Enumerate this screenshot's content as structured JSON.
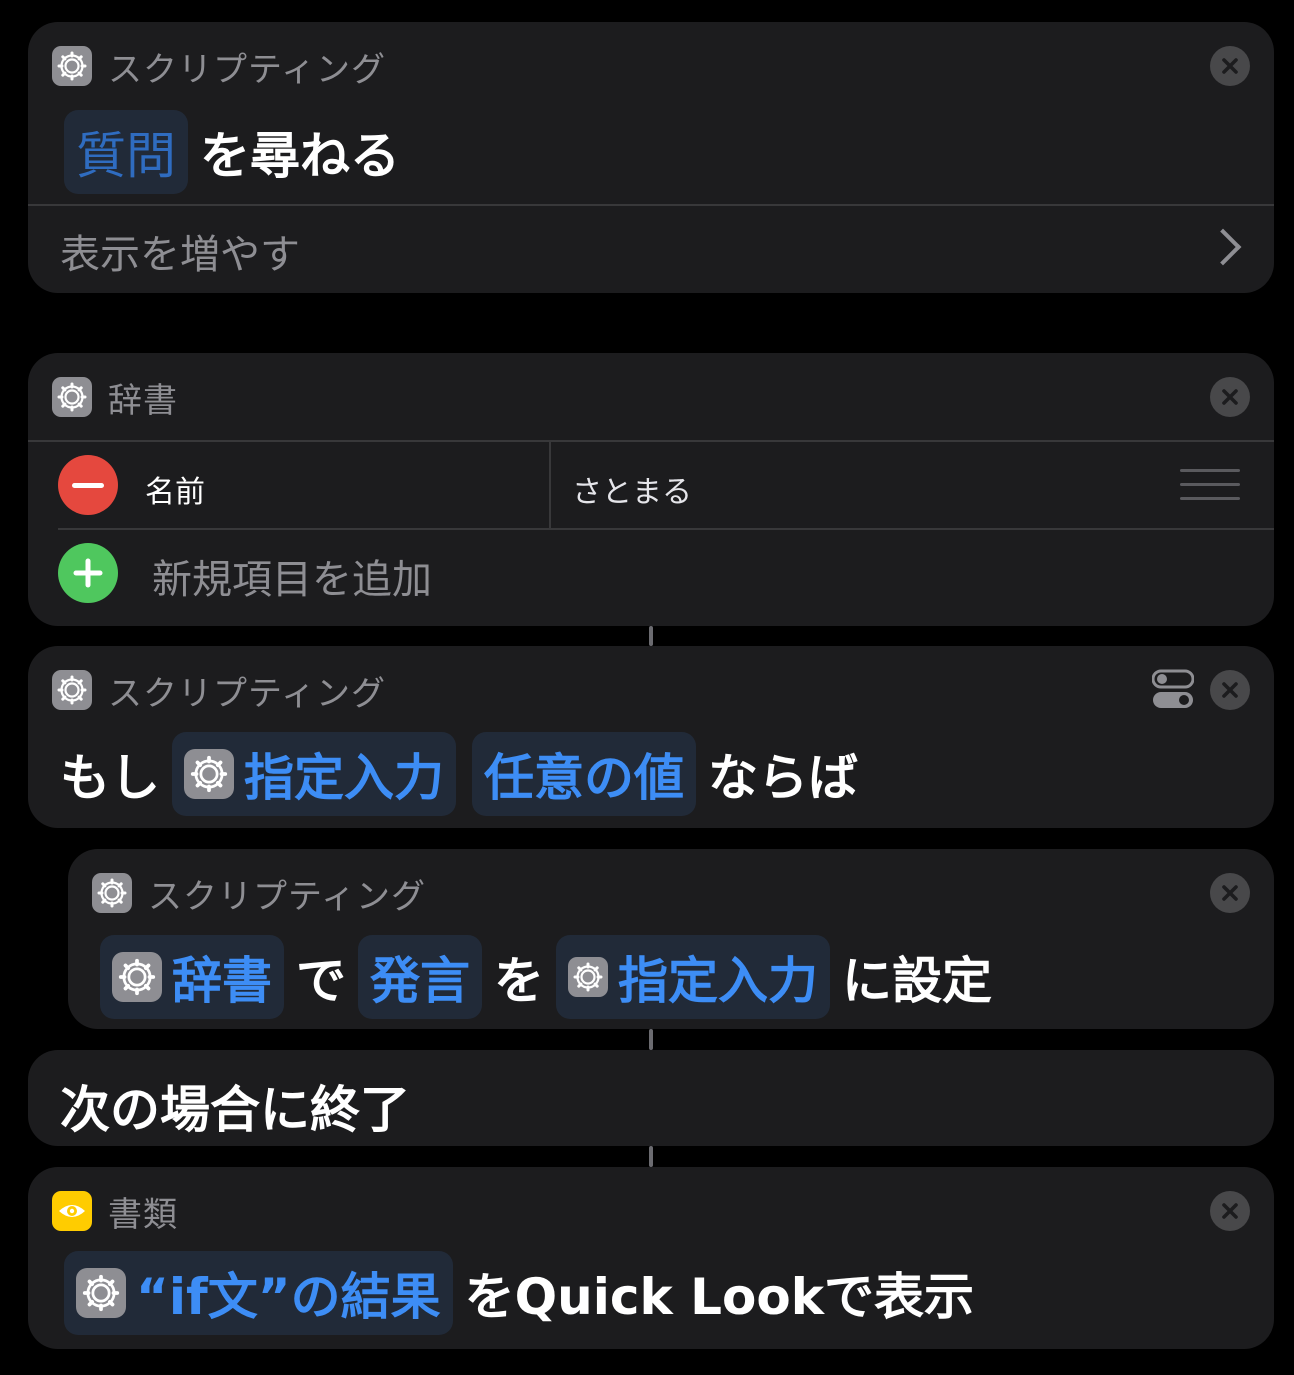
{
  "card1": {
    "category": "スクリプティング",
    "token": "質問",
    "action": "を尋ねる",
    "show_more": "表示を増やす"
  },
  "card2": {
    "category": "辞書",
    "key": "名前",
    "value": "さとまる",
    "add_label": "新規項目を追加"
  },
  "card3": {
    "category": "スクリプティング",
    "prefix": "もし",
    "token1": "指定入力",
    "token2": "任意の値",
    "suffix": "ならば"
  },
  "card4": {
    "category": "スクリプティング",
    "token1": "辞書",
    "text1": "で",
    "token2": "発言",
    "text2": "を",
    "token3": "指定入力",
    "suffix": "に設定"
  },
  "card5": {
    "text": "次の場合に終了"
  },
  "card6": {
    "category": "書類",
    "token": "“if文”の結果",
    "suffix": "をQuick Lookで表示"
  },
  "colors": {
    "background": "#000000",
    "card": "#1c1c1e",
    "token_text": "#3d8df5",
    "token_bg": "#212a38",
    "muted": "#8e8e93",
    "minus": "#e5483e",
    "plus": "#4fc75e",
    "eye_icon": "#ffcc00"
  },
  "icons": [
    "gear-icon",
    "close-icon",
    "chevron-right-icon",
    "toggle-icon",
    "minus-icon",
    "plus-icon",
    "drag-handle-icon",
    "eye-icon"
  ]
}
